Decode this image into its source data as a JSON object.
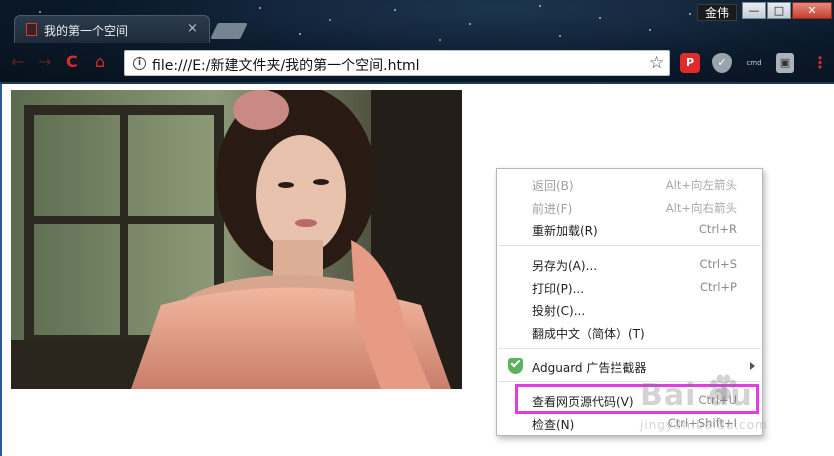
{
  "browser": {
    "tab_title": "我的第一个空间",
    "tab_close": "×",
    "user_name": "金伟",
    "window_controls": {
      "minimize": "—",
      "maximize": "□",
      "close": "✕"
    },
    "nav": {
      "back": "←",
      "forward": "→",
      "reload": "C",
      "home": "⌂"
    },
    "url": "file:///E:/新建文件夹/我的第一个空间.html",
    "bookmark_star": "☆",
    "extensions": [
      {
        "name": "p-extension-icon",
        "glyph": "P"
      },
      {
        "name": "adguard-extension-icon",
        "glyph": "✓"
      },
      {
        "name": "cmd-extension-icon",
        "glyph": "cmd"
      },
      {
        "name": "bag-extension-icon",
        "glyph": "▣"
      }
    ],
    "menu_glyph": "⋮"
  },
  "context_menu": {
    "items": [
      {
        "label": "返回(B)",
        "shortcut": "Alt+向左箭头",
        "disabled": true
      },
      {
        "label": "前进(F)",
        "shortcut": "Alt+向右箭头",
        "disabled": true
      },
      {
        "label": "重新加载(R)",
        "shortcut": "Ctrl+R",
        "disabled": false
      },
      {
        "label": "另存为(A)...",
        "shortcut": "Ctrl+S",
        "disabled": false
      },
      {
        "label": "打印(P)...",
        "shortcut": "Ctrl+P",
        "disabled": false
      },
      {
        "label": "投射(C)...",
        "shortcut": "",
        "disabled": false
      },
      {
        "label": "翻成中文（简体）(T)",
        "shortcut": "",
        "disabled": false
      },
      {
        "label": "Adguard 广告拦截器",
        "shortcut": "",
        "disabled": false
      },
      {
        "label": "查看网页源代码(V)",
        "shortcut": "Ctrl+U",
        "disabled": false
      },
      {
        "label": "检查(N)",
        "shortcut": "Ctrl+Shift+I",
        "disabled": false
      }
    ]
  },
  "watermark": {
    "logo": "Bai  du",
    "sub": "jingyan.baidu.com"
  },
  "colors": {
    "highlight": "#e23de2",
    "adguard_green": "#58b35a",
    "reload_red": "#e02a2a"
  }
}
